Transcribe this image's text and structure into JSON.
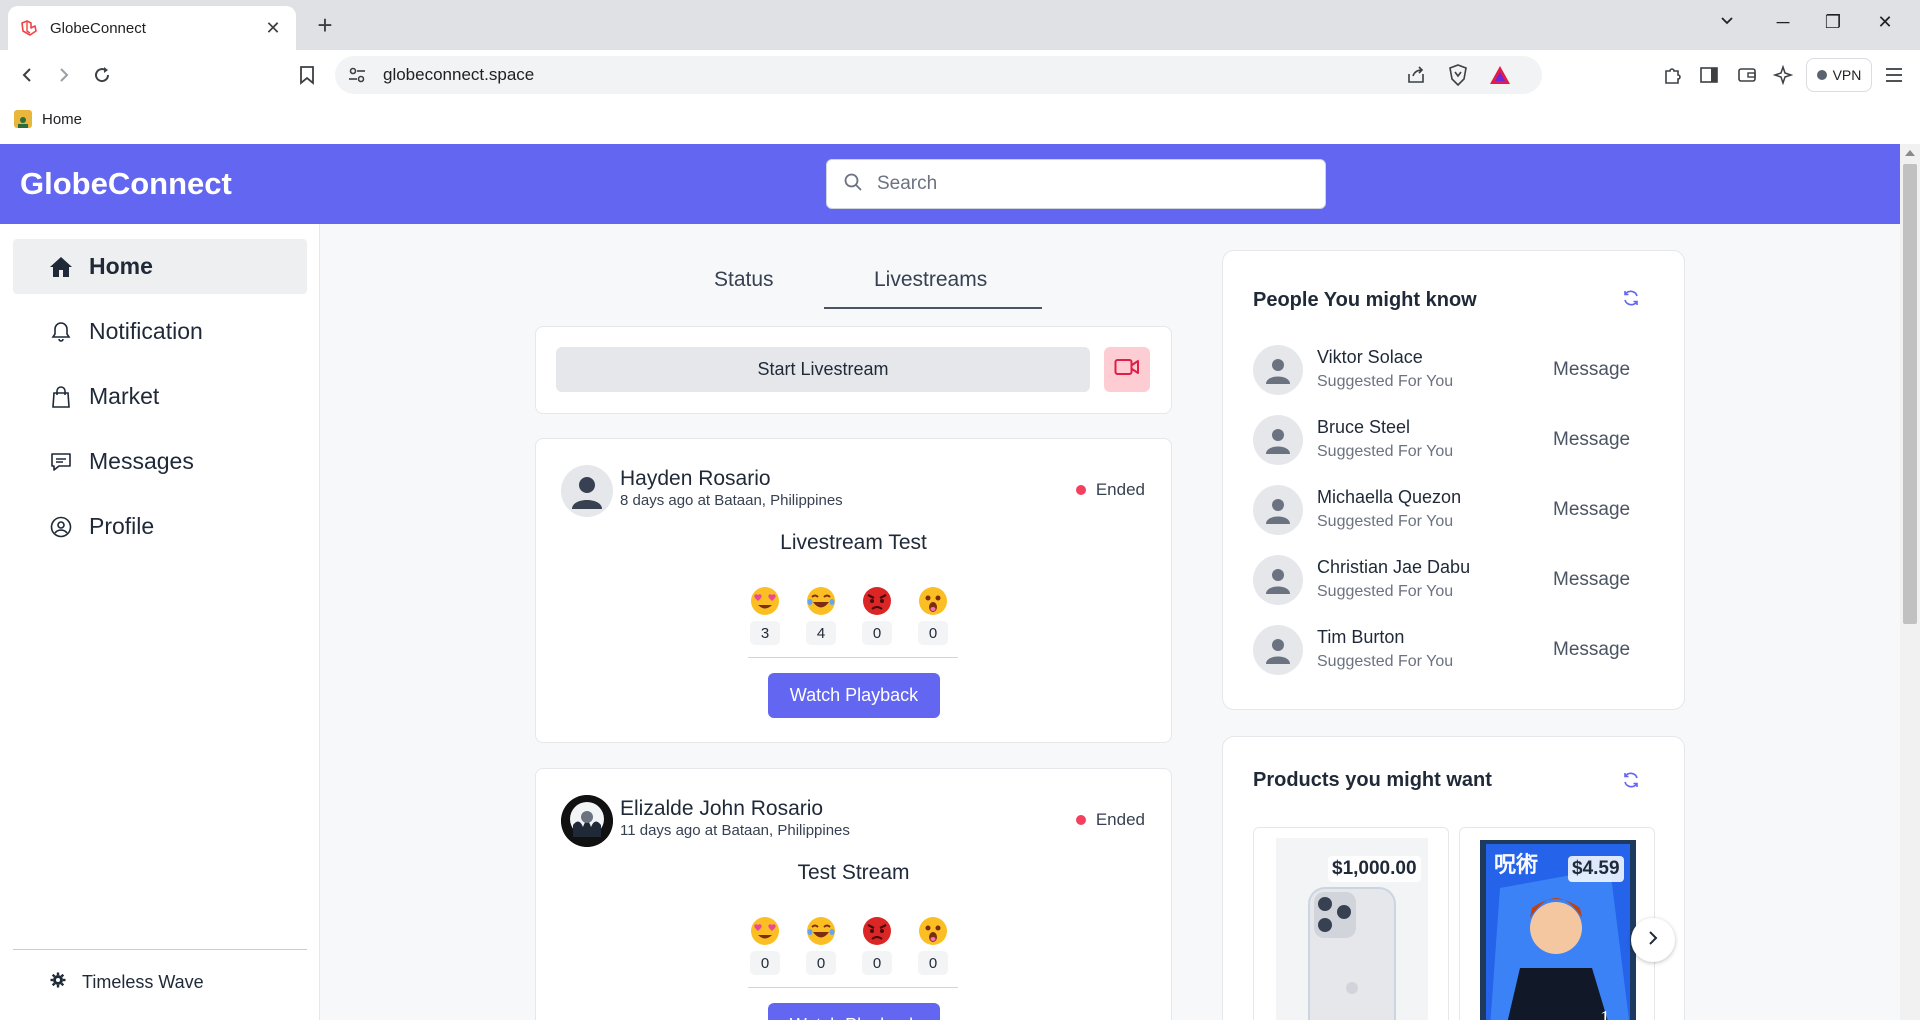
{
  "browser": {
    "tab_title": "GlobeConnect",
    "url": "globeconnect.space",
    "vpn_label": "VPN",
    "bookmark_label": "Home"
  },
  "header": {
    "brand": "GlobeConnect",
    "search_placeholder": "Search"
  },
  "sidebar": {
    "items": [
      {
        "label": "Home",
        "icon": "home-icon",
        "active": true
      },
      {
        "label": "Notification",
        "icon": "bell-icon"
      },
      {
        "label": "Market",
        "icon": "shopping-bag-icon"
      },
      {
        "label": "Messages",
        "icon": "chat-icon"
      },
      {
        "label": "Profile",
        "icon": "user-circle-icon"
      }
    ],
    "settings_label": "Timeless Wave"
  },
  "feed": {
    "tabs": [
      "Status",
      "Livestreams"
    ],
    "active_tab": "Livestreams",
    "start_livestream_label": "Start Livestream",
    "posts": [
      {
        "author": "Hayden Rosario",
        "time": "8 days ago",
        "location": "at Bataan, Philippines",
        "status": "Ended",
        "title": "Livestream Test",
        "reactions": [
          {
            "emoji": "heart-eyes-emoji",
            "count": "3"
          },
          {
            "emoji": "laughing-emoji",
            "count": "4"
          },
          {
            "emoji": "angry-emoji",
            "count": "0"
          },
          {
            "emoji": "surprised-emoji",
            "count": "0"
          }
        ],
        "button": "Watch Playback"
      },
      {
        "author": "Elizalde John Rosario",
        "time": "11 days ago",
        "location": "at Bataan, Philippines",
        "status": "Ended",
        "title": "Test Stream",
        "reactions": [
          {
            "emoji": "heart-eyes-emoji",
            "count": "0"
          },
          {
            "emoji": "laughing-emoji",
            "count": "0"
          },
          {
            "emoji": "angry-emoji",
            "count": "0"
          },
          {
            "emoji": "surprised-emoji",
            "count": "0"
          }
        ],
        "button": "Watch Playback"
      }
    ]
  },
  "people": {
    "title": "People You might know",
    "items": [
      {
        "name": "Viktor Solace",
        "subtitle": "Suggested For You",
        "action": "Message"
      },
      {
        "name": "Bruce Steel",
        "subtitle": "Suggested For You",
        "action": "Message"
      },
      {
        "name": "Michaella Quezon",
        "subtitle": "Suggested For You",
        "action": "Message"
      },
      {
        "name": "Christian Jae Dabu",
        "subtitle": "Suggested For You",
        "action": "Message"
      },
      {
        "name": "Tim Burton",
        "subtitle": "Suggested For You",
        "action": "Message"
      }
    ]
  },
  "products": {
    "title": "Products you might want",
    "items": [
      {
        "price": "$1,000.00"
      },
      {
        "price": "$4.59"
      }
    ]
  },
  "colors": {
    "accent": "#6366f1",
    "status_ended": "#f43f5e",
    "camera_button": "#fecdd3"
  }
}
